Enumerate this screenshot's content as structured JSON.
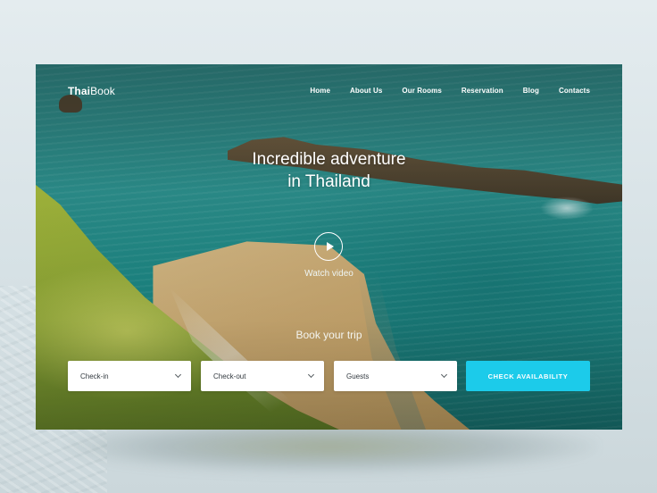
{
  "brand": {
    "bold": "Thai",
    "light": "Book"
  },
  "nav": {
    "items": [
      {
        "label": "Home"
      },
      {
        "label": "About Us"
      },
      {
        "label": "Our Rooms"
      },
      {
        "label": "Reservation"
      },
      {
        "label": "Blog"
      },
      {
        "label": "Contacts"
      }
    ]
  },
  "hero": {
    "headline_line1": "Incredible adventure",
    "headline_line2": "in Thailand",
    "watch_video": "Watch video",
    "play_icon": "play-icon"
  },
  "booking": {
    "title": "Book your trip",
    "checkin": "Check-in",
    "checkout": "Check-out",
    "guests": "Guests",
    "cta": "CHECK AVAILABILITY",
    "cta_color": "#1ccbea"
  }
}
